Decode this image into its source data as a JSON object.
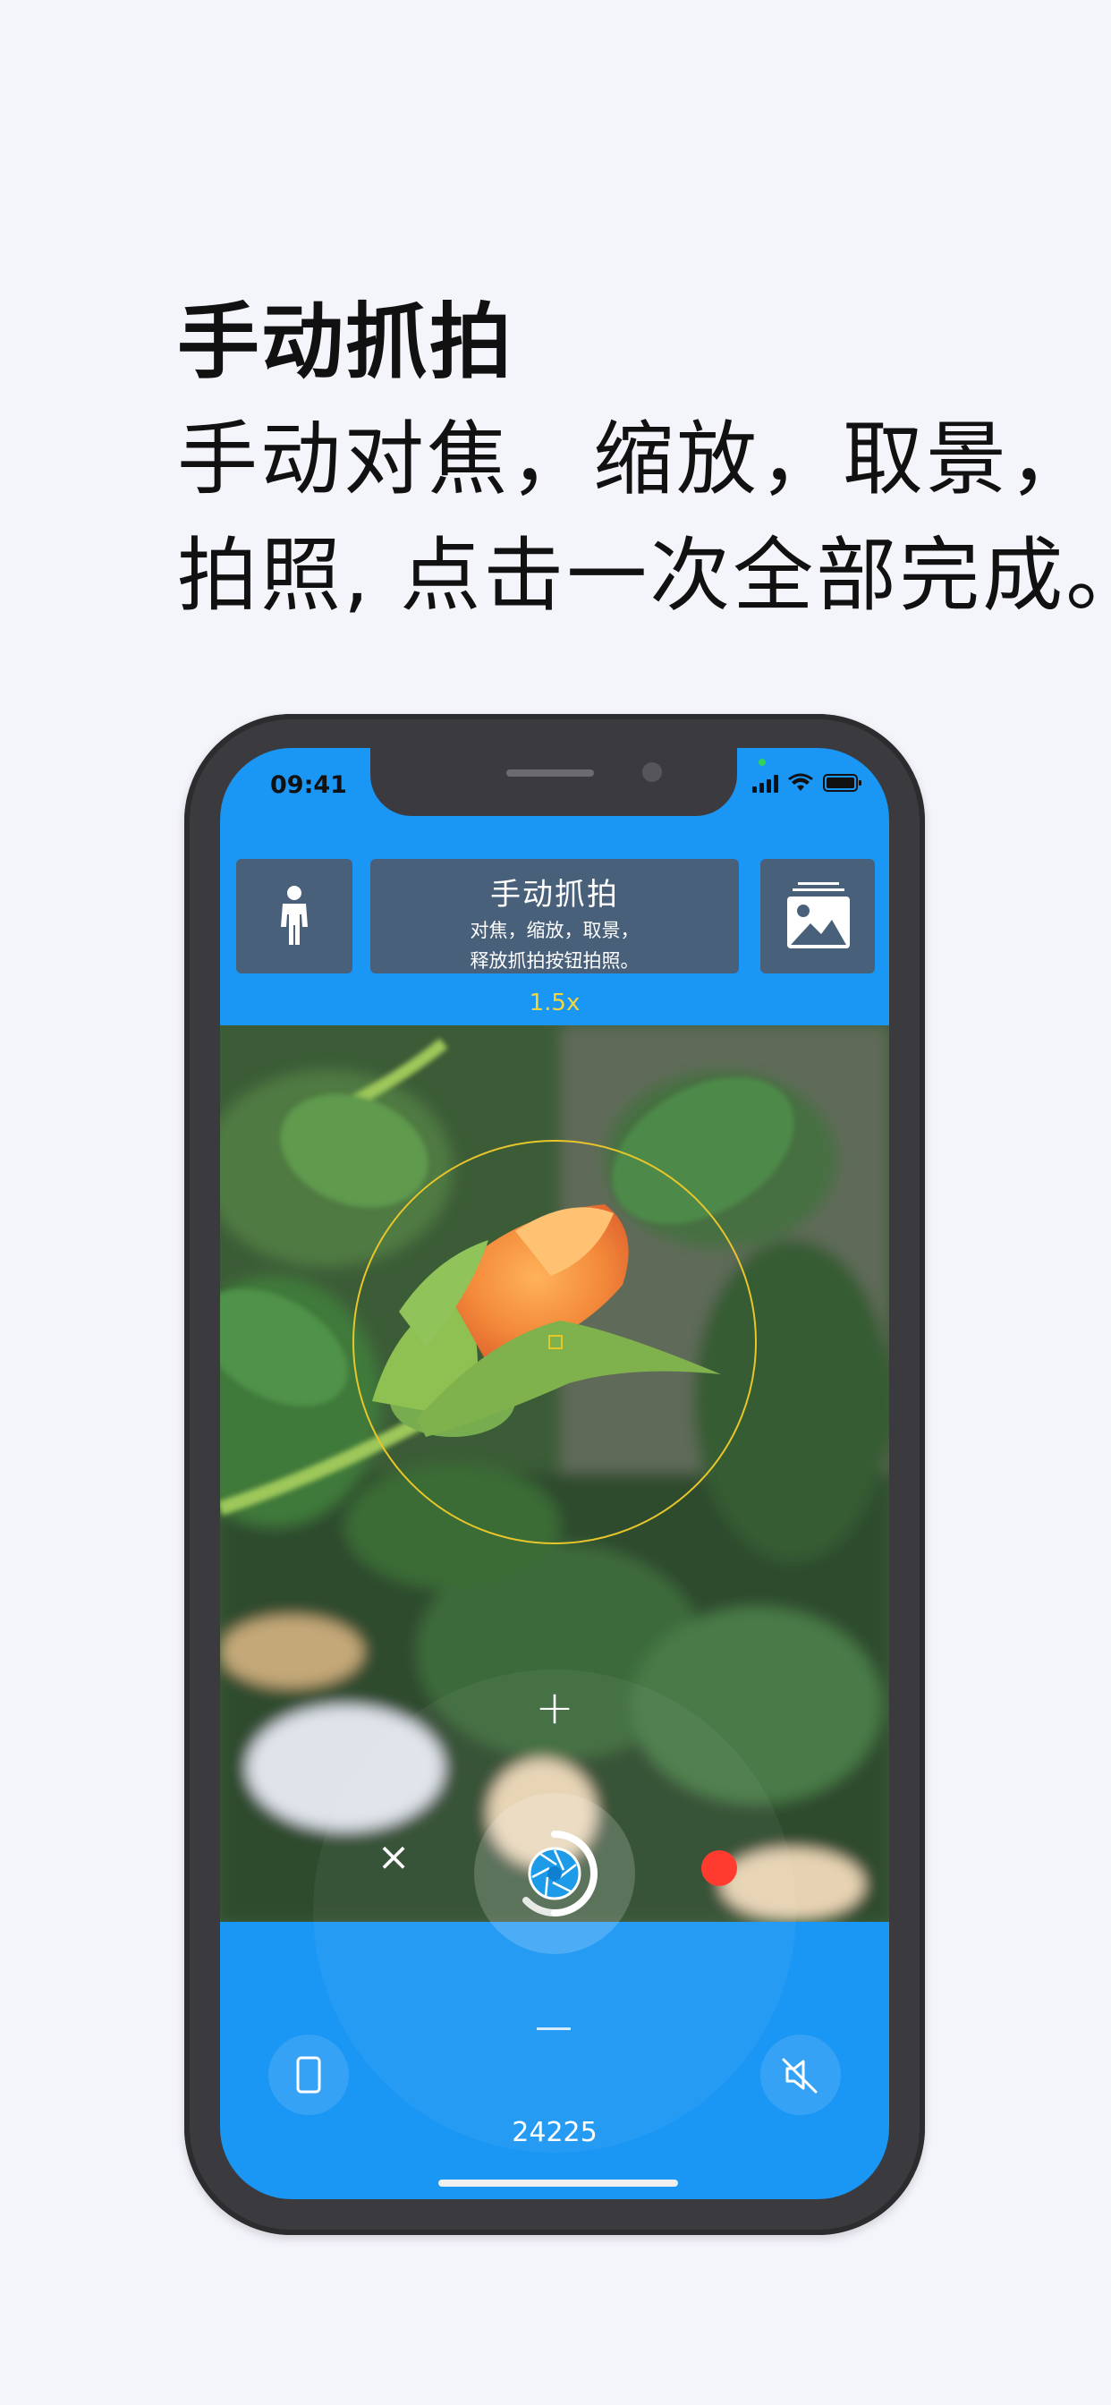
{
  "promo": {
    "title": "手动抓拍",
    "line1": "手动对焦，缩放，取景，",
    "line2": "拍照, 点击一次全部完成。"
  },
  "status_bar": {
    "time": "09:41"
  },
  "toolbar": {
    "mode_title": "手动抓拍",
    "mode_sub1": "对焦，缩放，取景，",
    "mode_sub2": "释放抓拍按钮拍照。",
    "left_icon": "person-icon",
    "right_icon": "gallery-icon"
  },
  "camera": {
    "zoom": "1.5x",
    "counter": "24225",
    "plus_glyph": "+",
    "close_glyph": "×"
  },
  "colors": {
    "screen_bg": "#1a96f4",
    "tile_bg": "#48607a",
    "focus_ring": "#e8c62a",
    "record": "#ff3b30"
  }
}
